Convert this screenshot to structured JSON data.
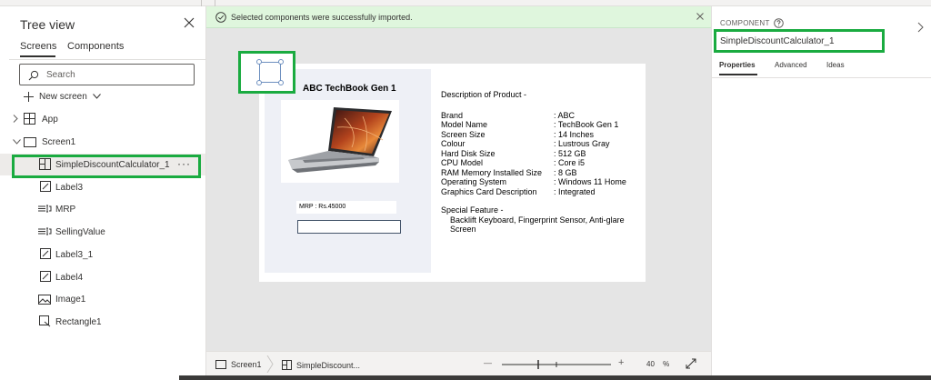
{
  "tree": {
    "title": "Tree view",
    "tabs": [
      "Screens",
      "Components"
    ],
    "search_placeholder": "Search",
    "new_screen_label": "New screen",
    "items": [
      {
        "label": "App",
        "icon": "app-icon"
      },
      {
        "label": "Screen1",
        "icon": "screen-icon"
      },
      {
        "label": "SimpleDiscountCalculator_1",
        "icon": "component-icon",
        "more": "···"
      },
      {
        "label": "Label3",
        "icon": "label-icon"
      },
      {
        "label": "MRP",
        "icon": "text-input-icon"
      },
      {
        "label": "SellingValue",
        "icon": "text-input-icon"
      },
      {
        "label": "Label3_1",
        "icon": "label-icon"
      },
      {
        "label": "Label4",
        "icon": "label-icon"
      },
      {
        "label": "Image1",
        "icon": "image-icon"
      },
      {
        "label": "Rectangle1",
        "icon": "rectangle-icon"
      }
    ]
  },
  "banner": {
    "message": "Selected components were successfully imported."
  },
  "product": {
    "title": "ABC TechBook Gen 1",
    "mrp_text": "MRP : Rs.45000",
    "description_title": "Description of Product -",
    "specs": [
      {
        "key": "Brand",
        "value": ": ABC"
      },
      {
        "key": "Model Name",
        "value": ": TechBook Gen 1"
      },
      {
        "key": "Screen Size",
        "value": ": 14 Inches"
      },
      {
        "key": "Colour",
        "value": ": Lustrous Gray"
      },
      {
        "key": "Hard Disk Size",
        "value": ": 512 GB"
      },
      {
        "key": "CPU Model",
        "value": ": Core i5"
      },
      {
        "key": "RAM Memory Installed Size",
        "value": ":  8 GB"
      },
      {
        "key": "Operating System",
        "value": " : Windows 11 Home"
      },
      {
        "key": "Graphics Card Description",
        "value": " : Integrated"
      }
    ],
    "feature_title": "Special Feature -",
    "feature_body": "Backlift Keyboard, Fingerprint Sensor, Anti-glare Screen"
  },
  "footer": {
    "crumb_screen": "Screen1",
    "crumb_component": "SimpleDiscount...",
    "zoom_minus": "—",
    "zoom_plus": "+",
    "zoom_value": "40",
    "zoom_unit": "%"
  },
  "right_panel": {
    "section_label": "COMPONENT",
    "component_name": "SimpleDiscountCalculator_1",
    "tabs": [
      "Properties",
      "Advanced",
      "Ideas"
    ]
  },
  "colors": {
    "highlight_green": "#1aab40",
    "banner_bg": "#dff6dd",
    "canvas_bg": "#e5e5e5"
  }
}
